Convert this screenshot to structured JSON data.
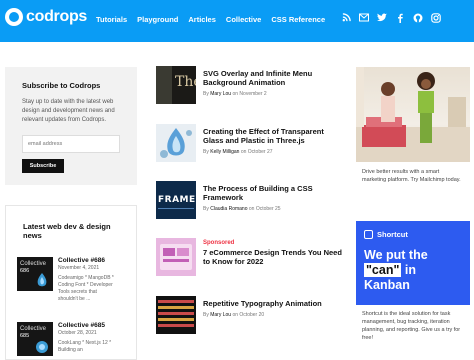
{
  "header": {
    "logo": "codrops",
    "nav": [
      "Tutorials",
      "Playground",
      "Articles",
      "Collective",
      "CSS Reference"
    ],
    "social_icons": [
      "rss-icon",
      "mail-icon",
      "twitter-icon",
      "facebook-icon",
      "github-icon",
      "instagram-icon"
    ],
    "brand_color": "#0a9cf5"
  },
  "subscribe": {
    "title": "Subscribe to Codrops",
    "text": "Stay up to date with the latest web design and development news and relevant updates from Codrops.",
    "email_placeholder": "email address",
    "button": "Subscribe"
  },
  "latest": {
    "title": "Latest web dev & design news",
    "items": [
      {
        "thumb_title": "Collective",
        "thumb_number": "686",
        "title": "Collective #686",
        "date": "November 4, 2021",
        "excerpt": "Codeamigo * MangoDB * Coding Font * Developer Tools secrets that shouldn't be ..."
      },
      {
        "thumb_title": "Collective",
        "thumb_number": "685",
        "title": "Collective #685",
        "date": "October 28, 2021",
        "excerpt": "CookLang * Next.js 12 * Building an"
      }
    ]
  },
  "articles": [
    {
      "title": "SVG Overlay and Infinite Menu Background Animation",
      "by": "By",
      "author": "Mary Lou",
      "on": "on",
      "date": "November 2",
      "sponsored": ""
    },
    {
      "title": "Creating the Effect of Transparent Glass and Plastic in Three.js",
      "by": "By",
      "author": "Kelly Milligan",
      "on": "on",
      "date": "October 27",
      "sponsored": ""
    },
    {
      "title": "The Process of Building a CSS Framework",
      "by": "By",
      "author": "Claudia Romano",
      "on": "on",
      "date": "October 25",
      "sponsored": ""
    },
    {
      "title": "7 eCommerce Design Trends You Need to Know for 2022",
      "by": "",
      "author": "",
      "on": "",
      "date": "",
      "sponsored": "Sponsored"
    },
    {
      "title": "Repetitive Typography Animation",
      "by": "By",
      "author": "Mary Lou",
      "on": "on",
      "date": "October 20",
      "sponsored": ""
    }
  ],
  "thumbs": {
    "a1_text": "The",
    "a3_text": "FRAMEW"
  },
  "ads": {
    "ad1_text": "Drive better results with a smart marketing platform. Try Mailchimp today.",
    "ad2_brand": "Shortcut",
    "ad2_head_1": "We put the",
    "ad2_can": "\"can\"",
    "ad2_head_2": "in Kanban",
    "ad2_text": "Shortcut is the ideal solution for task management, bug tracking, iteration planning, and reporting. Give us a try for free!"
  }
}
